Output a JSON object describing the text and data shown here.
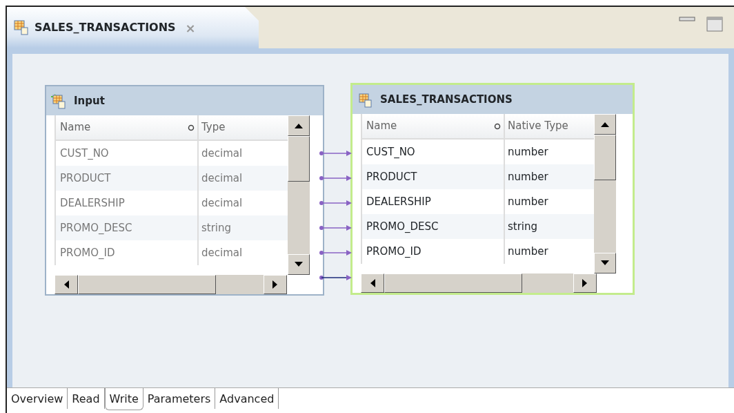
{
  "editor_tab": {
    "title": "SALES_TRANSACTIONS",
    "close": "×"
  },
  "source": {
    "title": "Input",
    "columns": [
      "Name",
      "Type"
    ],
    "rows": [
      {
        "name": "CUST_NO",
        "type": "decimal"
      },
      {
        "name": "PRODUCT",
        "type": "decimal"
      },
      {
        "name": "DEALERSHIP",
        "type": "decimal"
      },
      {
        "name": "PROMO_DESC",
        "type": "string"
      },
      {
        "name": "PROMO_ID",
        "type": "decimal"
      }
    ]
  },
  "target": {
    "title": "SALES_TRANSACTIONS",
    "selected": true,
    "columns": [
      "Name",
      "Native Type"
    ],
    "rows": [
      {
        "name": "CUST_NO",
        "type": "number"
      },
      {
        "name": "PRODUCT",
        "type": "number"
      },
      {
        "name": "DEALERSHIP",
        "type": "number"
      },
      {
        "name": "PROMO_DESC",
        "type": "string"
      },
      {
        "name": "PROMO_ID",
        "type": "number"
      }
    ]
  },
  "bottom_tabs": [
    {
      "label": "Overview",
      "selected": false
    },
    {
      "label": "Read",
      "selected": false
    },
    {
      "label": "Write",
      "selected": true
    },
    {
      "label": "Parameters",
      "selected": false
    },
    {
      "label": "Advanced",
      "selected": false
    }
  ]
}
